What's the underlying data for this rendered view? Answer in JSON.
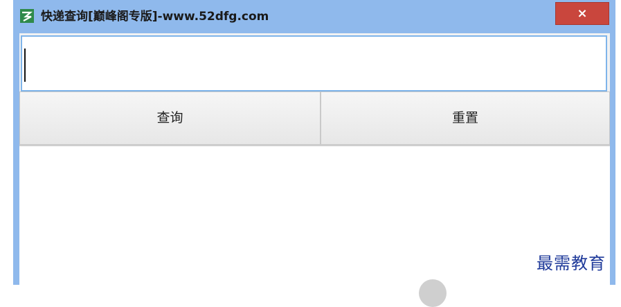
{
  "window": {
    "title": "快递查询[巅峰阁专版]-www.52dfg.com",
    "icon": "app-logo-icon",
    "close_label": "×"
  },
  "form": {
    "query_value": "",
    "query_button": "查询",
    "reset_button": "重置"
  },
  "watermark": "最需教育",
  "colors": {
    "titlebar": "#8fb9ec",
    "close_button": "#c9463d",
    "watermark": "#1f3a9a"
  }
}
